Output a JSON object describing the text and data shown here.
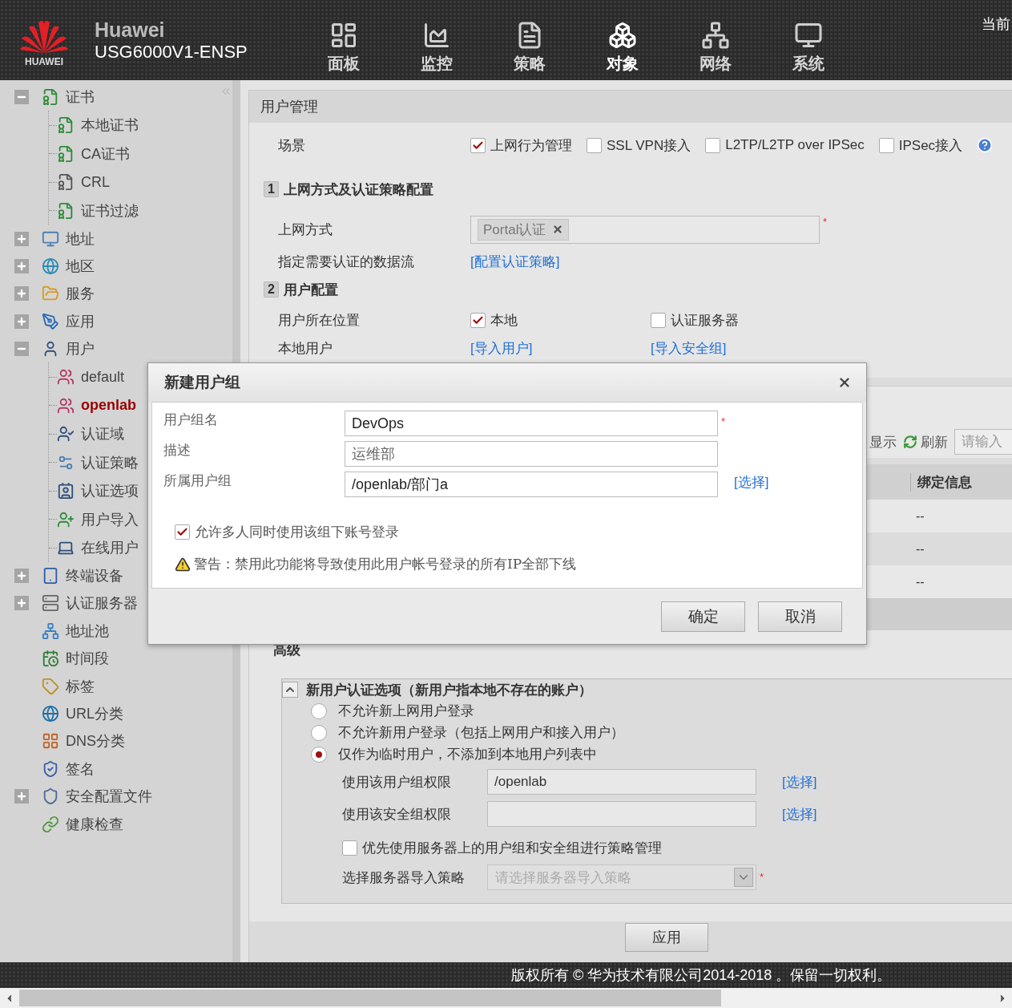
{
  "header": {
    "logo_text": "HUAWEI",
    "brand": "Huawei",
    "model": "USG6000V1-ENSP",
    "corner_text": "当前",
    "nav": [
      {
        "label": "面板",
        "selected": false
      },
      {
        "label": "监控",
        "selected": false
      },
      {
        "label": "策略",
        "selected": false
      },
      {
        "label": "对象",
        "selected": true
      },
      {
        "label": "网络",
        "selected": false
      },
      {
        "label": "系统",
        "selected": false
      }
    ]
  },
  "sidebar": {
    "items": [
      {
        "label": "证书",
        "expanded": true,
        "selected": false,
        "children": [
          {
            "label": "本地证书",
            "selected": false
          },
          {
            "label": "CA证书",
            "selected": false
          },
          {
            "label": "CRL",
            "selected": false
          },
          {
            "label": "证书过滤",
            "selected": false
          }
        ]
      },
      {
        "label": "地址",
        "expanded": false,
        "selected": false
      },
      {
        "label": "地区",
        "expanded": false,
        "selected": false
      },
      {
        "label": "服务",
        "expanded": false,
        "selected": false
      },
      {
        "label": "应用",
        "expanded": false,
        "selected": false
      },
      {
        "label": "用户",
        "expanded": true,
        "selected": false,
        "children": [
          {
            "label": "default",
            "selected": false
          },
          {
            "label": "openlab",
            "selected": true
          },
          {
            "label": "认证域",
            "selected": false
          },
          {
            "label": "认证策略",
            "selected": false
          },
          {
            "label": "认证选项",
            "selected": false
          },
          {
            "label": "用户导入",
            "selected": false
          },
          {
            "label": "在线用户",
            "selected": false
          }
        ]
      },
      {
        "label": "终端设备",
        "expanded": false,
        "selected": false
      },
      {
        "label": "认证服务器",
        "expanded": false,
        "selected": false
      },
      {
        "label": "地址池",
        "selected": false
      },
      {
        "label": "时间段",
        "selected": false
      },
      {
        "label": "标签",
        "selected": false
      },
      {
        "label": "URL分类",
        "selected": false
      },
      {
        "label": "DNS分类",
        "selected": false
      },
      {
        "label": "签名",
        "selected": false
      },
      {
        "label": "安全配置文件",
        "expanded": false,
        "selected": false
      },
      {
        "label": "健康检查",
        "selected": false
      }
    ]
  },
  "panel": {
    "title": "用户管理",
    "scene": {
      "label": "场景",
      "options": [
        {
          "label": "上网行为管理",
          "checked": true
        },
        {
          "label": "SSL VPN接入",
          "checked": false
        },
        {
          "label": "L2TP/L2TP over IPSec",
          "checked": false
        },
        {
          "label": "IPSec接入",
          "checked": false
        }
      ]
    },
    "section1": {
      "number": "1",
      "title": "上网方式及认证策略配置",
      "access_label": "上网方式",
      "access_tags": [
        "Portal认证"
      ],
      "required_mark": "*",
      "flow_label": "指定需要认证的数据流",
      "flow_link": "[配置认证策略]"
    },
    "section2": {
      "number": "2",
      "title": "用户配置",
      "location_label": "用户所在位置",
      "locations": [
        {
          "label": "本地",
          "checked": true
        },
        {
          "label": "认证服务器",
          "checked": false
        }
      ],
      "local_user_label": "本地用户",
      "links": [
        "[导入用户]",
        "[导入安全组]"
      ]
    },
    "list": {
      "show": "显示",
      "refresh": "刷新",
      "search_placeholder": "请输入",
      "column": "绑定信息",
      "rows": [
        "--",
        "--",
        "--"
      ]
    },
    "section3": {
      "title": "高级"
    },
    "new_user_box": {
      "title": "新用户认证选项（新用户指本地不存在的账户）",
      "expanded": true,
      "options": [
        {
          "label": "不允许新上网用户登录",
          "selected": false
        },
        {
          "label": "不允许新用户登录（包括上网用户和接入用户）",
          "selected": false
        },
        {
          "label": "仅作为临时用户，不添加到本地用户列表中",
          "selected": true
        }
      ],
      "group_label": "使用该用户组权限",
      "group_value": "/openlab",
      "group_link": "[选择]",
      "secgroup_label": "使用该安全组权限",
      "secgroup_link": "[选择]",
      "prefer": {
        "label": "优先使用服务器上的用户组和安全组进行策略管理",
        "checked": false
      },
      "policy_label": "选择服务器导入策略",
      "policy_placeholder": "请选择服务器导入策略",
      "required_mark": "*"
    },
    "apply_button": "应用"
  },
  "dialog": {
    "title": "新建用户组",
    "fields": [
      {
        "label": "用户组名",
        "value": "DevOps",
        "required_mark": "*"
      },
      {
        "label": "描述",
        "value": "运维部"
      },
      {
        "label": "所属用户组",
        "value": "/openlab/部门a",
        "link": "[选择]"
      }
    ],
    "allow_multi": {
      "label": "允许多人同时使用该组下账号登录",
      "checked": true
    },
    "warning": "警告：禁用此功能将导致使用此用户帐号登录的所有IP全部下线",
    "buttons": [
      "确定",
      "取消"
    ]
  },
  "footer": {
    "copyright": "版权所有 © 华为技术有限公司2014-2018 。保留一切权利。"
  }
}
